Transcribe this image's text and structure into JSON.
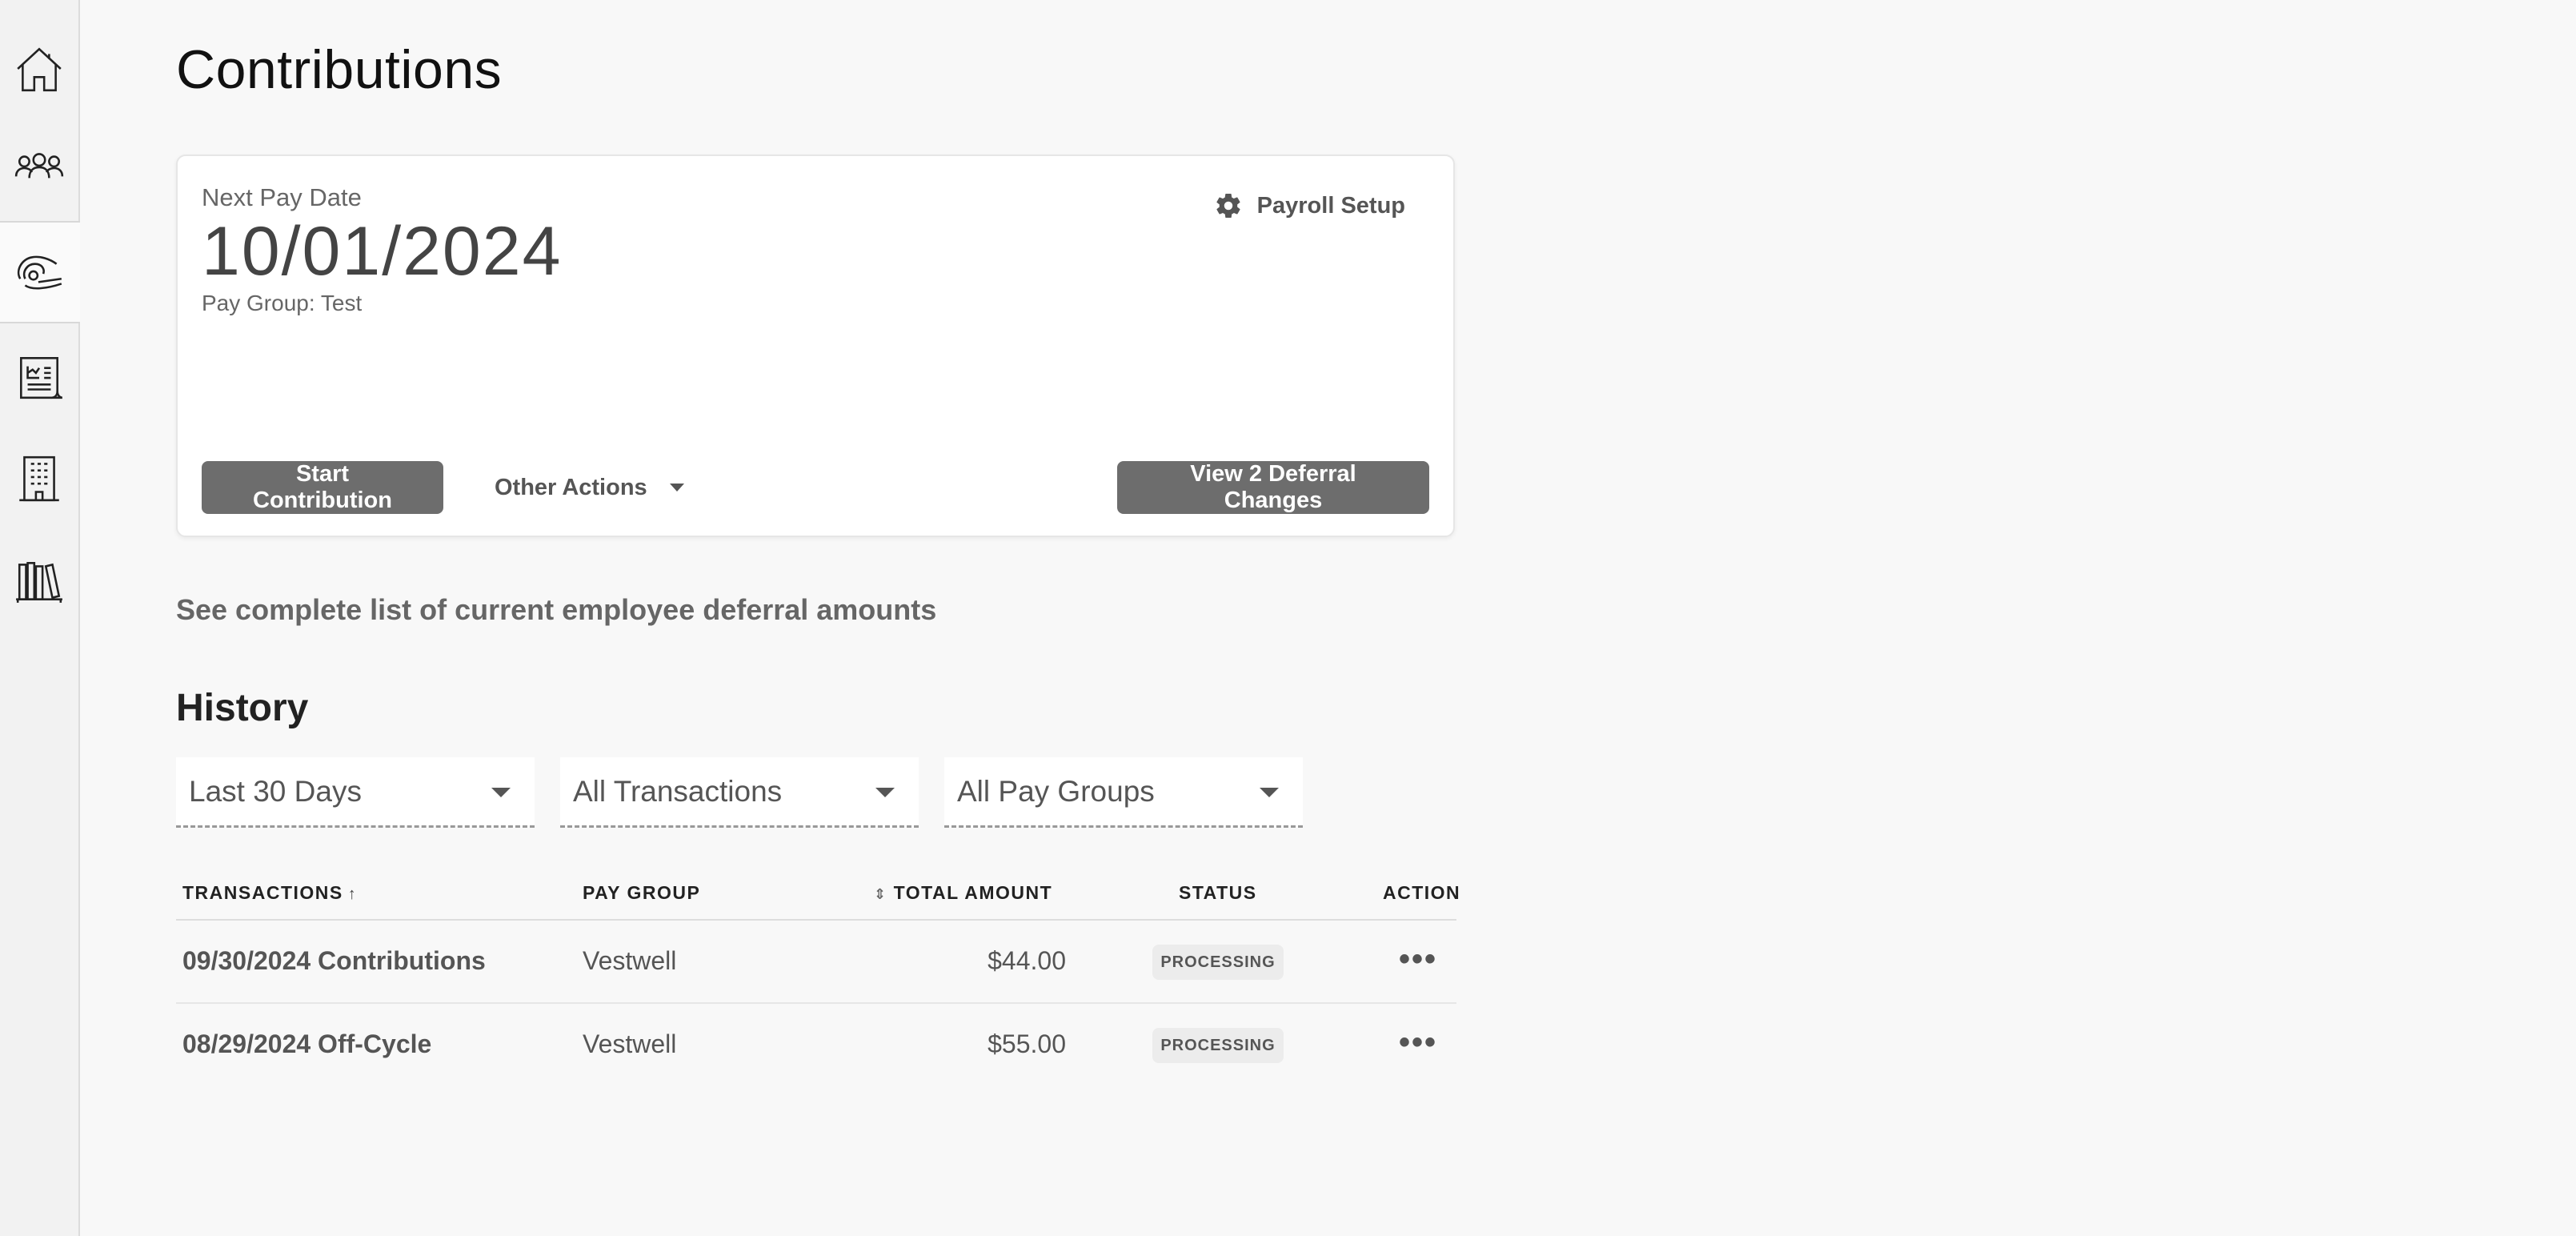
{
  "page": {
    "title": "Contributions"
  },
  "sidebar": {
    "items": [
      {
        "icon": "home-icon"
      },
      {
        "icon": "people-icon"
      },
      {
        "icon": "contributions-icon",
        "active": true
      },
      {
        "icon": "document-icon"
      },
      {
        "icon": "building-icon"
      },
      {
        "icon": "library-icon"
      }
    ]
  },
  "card": {
    "next_pay_label": "Next Pay Date",
    "next_pay_date": "10/01/2024",
    "pay_group": "Pay Group: Test",
    "payroll_setup": "Payroll Setup",
    "start_contribution": "Start Contribution",
    "other_actions": "Other Actions",
    "view_deferrals": "View 2 Deferral Changes"
  },
  "deferral_link": "See complete list of current employee deferral amounts",
  "history": {
    "title": "History",
    "filters": {
      "range": "Last 30 Days",
      "transactions": "All Transactions",
      "pay_groups": "All Pay Groups"
    },
    "columns": {
      "transactions": "TRANSACTIONS",
      "pay_group": "PAY GROUP",
      "total_amount": "TOTAL AMOUNT",
      "status": "STATUS",
      "action": "ACTION"
    },
    "rows": [
      {
        "transaction": "09/30/2024 Contributions",
        "pay_group": "Vestwell",
        "amount": "$44.00",
        "status": "PROCESSING"
      },
      {
        "transaction": "08/29/2024 Off-Cycle",
        "pay_group": "Vestwell",
        "amount": "$55.00",
        "status": "PROCESSING"
      }
    ]
  }
}
